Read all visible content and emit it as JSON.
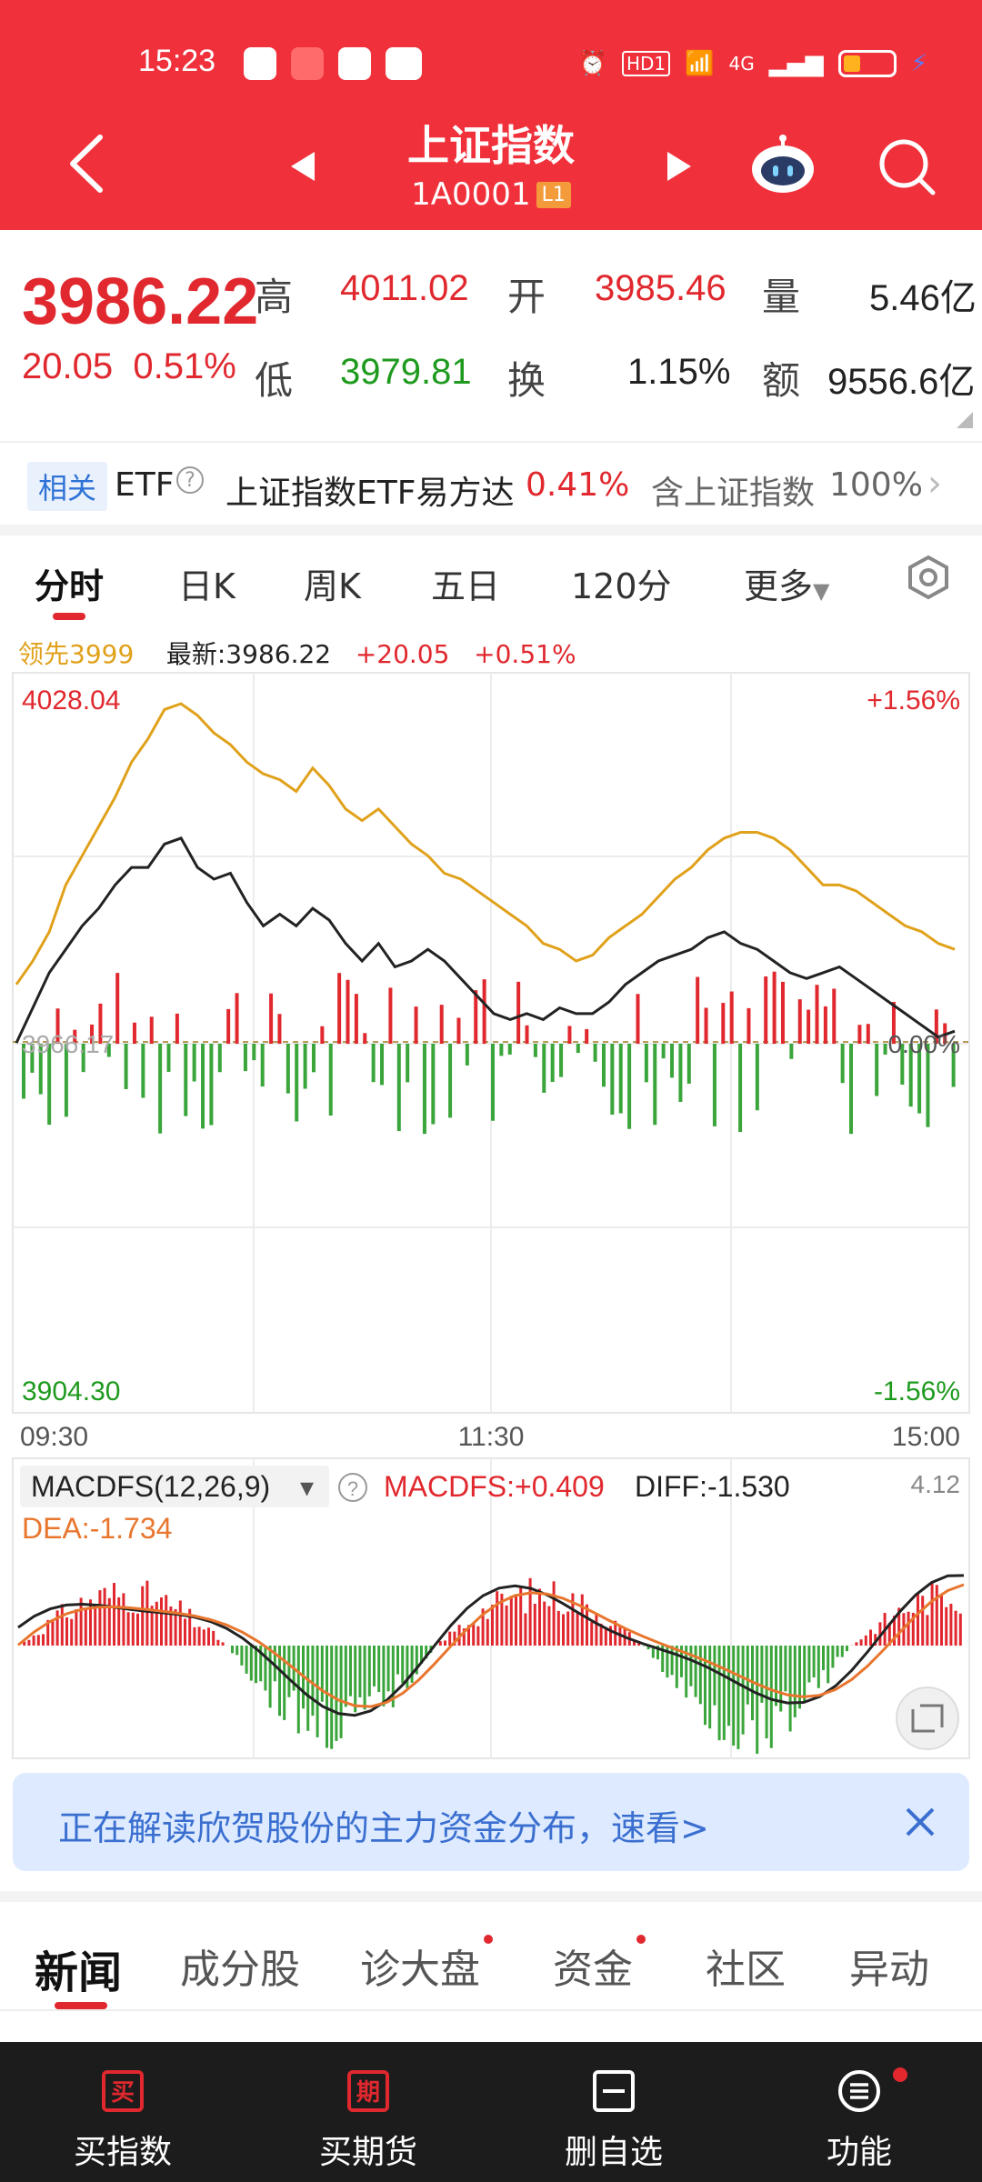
{
  "status_bar": {
    "time": "15:23",
    "network": "4G",
    "hd": "HD1"
  },
  "nav": {
    "title": "上证指数",
    "code": "1A0001",
    "level": "L1"
  },
  "quote": {
    "price": "3986.22",
    "change": "20.05",
    "change_pct": "0.51%",
    "high_label": "高",
    "high": "4011.02",
    "low_label": "低",
    "low": "3979.81",
    "open_label": "开",
    "open": "3985.46",
    "turnover_label": "换",
    "turnover": "1.15%",
    "volume_label": "量",
    "volume": "5.46亿",
    "amount_label": "额",
    "amount": "9556.6亿"
  },
  "etf": {
    "tag": "相关",
    "etf_label": "ETF",
    "name": "上证指数ETF易方达",
    "pct": "0.41%",
    "contain": "含上证指数",
    "weight": "100%"
  },
  "tabs": [
    "分时",
    "日K",
    "周K",
    "五日",
    "120分",
    "更多"
  ],
  "chart_info": {
    "lead": "领先3999",
    "latest": "最新:3986.22",
    "chg": "+20.05",
    "pct": "+0.51%"
  },
  "chart_data": {
    "type": "line",
    "y_max_label": "4028.04",
    "y_min_label": "3904.30",
    "y_mid_label": "3966.17",
    "pct_top": "+1.56%",
    "pct_mid": "0.00%",
    "pct_bottom": "-1.56%",
    "x_labels": [
      "09:30",
      "11:30",
      "15:00"
    ],
    "ylim": [
      3904.3,
      4028.04
    ],
    "series": [
      {
        "name": "领先",
        "color": "#e0a11b",
        "values": [
          3976,
          3980,
          3985,
          3993,
          3998,
          4003,
          4008,
          4014,
          4018,
          4023,
          4024,
          4022,
          4019,
          4017,
          4014,
          4012,
          4011,
          4009,
          4013,
          4010,
          4006,
          4004,
          4006,
          4003,
          4000,
          3998,
          3995,
          3994,
          3992,
          3990,
          3988,
          3986,
          3983,
          3982,
          3980,
          3981,
          3984,
          3986,
          3988,
          3991,
          3994,
          3996,
          3999,
          4001,
          4002,
          4002,
          4001,
          3999,
          3996,
          3993,
          3993,
          3992,
          3990,
          3988,
          3986,
          3985,
          3983,
          3982
        ]
      },
      {
        "name": "上证指数",
        "color": "#222222",
        "values": [
          3966,
          3972,
          3978,
          3982,
          3986,
          3989,
          3993,
          3996,
          3996,
          4000,
          4001,
          3996,
          3994,
          3995,
          3990,
          3986,
          3988,
          3986,
          3989,
          3987,
          3983,
          3980,
          3983,
          3979,
          3980,
          3982,
          3980,
          3977,
          3974,
          3971,
          3970,
          3971,
          3970,
          3972,
          3971,
          3971,
          3973,
          3976,
          3978,
          3980,
          3981,
          3982,
          3984,
          3985,
          3983,
          3982,
          3980,
          3978,
          3977,
          3978,
          3979,
          3977,
          3975,
          3973,
          3971,
          3969,
          3967,
          3968
        ]
      }
    ]
  },
  "macd": {
    "label": "MACDFS(12,26,9)",
    "macdfs": "MACDFS:+0.409",
    "diff": "DIFF:-1.530",
    "dea": "DEA:-1.734",
    "ymax": "4.12"
  },
  "banner": {
    "text": "正在解读欣贺股份的主力资金分布，速看>"
  },
  "news_tabs": [
    "新闻",
    "成分股",
    "诊大盘",
    "资金",
    "社区",
    "异动"
  ],
  "bottom_bar": [
    {
      "label": "买指数",
      "icon_char": "买"
    },
    {
      "label": "买期货",
      "icon_char": "期"
    },
    {
      "label": "删自选",
      "icon_char": "一"
    },
    {
      "label": "功能",
      "icon_char": "☰"
    }
  ]
}
